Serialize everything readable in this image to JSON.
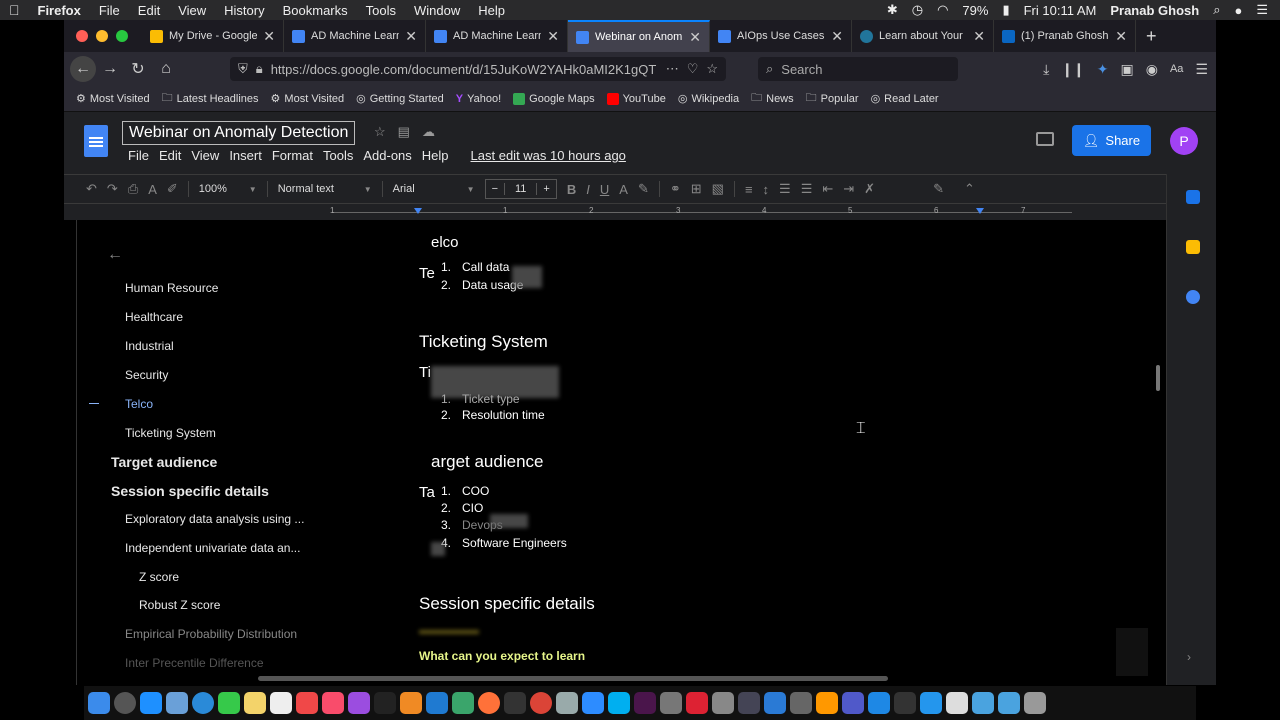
{
  "menubar": {
    "app": "Firefox",
    "items": [
      "File",
      "Edit",
      "View",
      "History",
      "Bookmarks",
      "Tools",
      "Window",
      "Help"
    ],
    "battery": "79%",
    "clock": "Fri 10:11 AM",
    "user": "Pranab Ghosh"
  },
  "tabs": [
    {
      "title": "My Drive - Google"
    },
    {
      "title": "AD Machine Learn"
    },
    {
      "title": "AD Machine Learn"
    },
    {
      "title": "Webinar on Anom"
    },
    {
      "title": "AIOps Use Cases"
    },
    {
      "title": "Learn about Your"
    },
    {
      "title": "(1) Pranab Ghosh"
    }
  ],
  "address": {
    "url": "https://docs.google.com/document/d/15JuKoW2YAHk0aMI2K1gQT",
    "search_placeholder": "Search"
  },
  "bookmarks": [
    "Most Visited",
    "Latest Headlines",
    "Most Visited",
    "Getting Started",
    "Yahoo!",
    "Google Maps",
    "YouTube",
    "Wikipedia",
    "News",
    "Popular",
    "Read Later"
  ],
  "docs": {
    "title": "Webinar on Anomaly Detection",
    "menus": [
      "File",
      "Edit",
      "View",
      "Insert",
      "Format",
      "Tools",
      "Add-ons",
      "Help"
    ],
    "last_edit": "Last edit was 10 hours ago",
    "share_label": "Share",
    "avatar_letter": "P"
  },
  "toolbar": {
    "zoom": "100%",
    "style": "Normal text",
    "font": "Arial",
    "font_size": "11",
    "minus": "−",
    "plus": "+"
  },
  "ruler_numbers": [
    "1",
    "1",
    "2",
    "3",
    "4",
    "5",
    "6",
    "7"
  ],
  "outline": {
    "items": [
      {
        "label": "Human Resource",
        "level": 2
      },
      {
        "label": "Healthcare",
        "level": 2
      },
      {
        "label": "Industrial",
        "level": 2
      },
      {
        "label": "Security",
        "level": 2
      },
      {
        "label": "Telco",
        "level": 2
      },
      {
        "label": "Ticketing System",
        "level": 2
      },
      {
        "label": "Target audience",
        "level": 1
      },
      {
        "label": "Session specific details",
        "level": 1
      },
      {
        "label": "Exploratory data analysis using ...",
        "level": 2
      },
      {
        "label": "Independent univariate data an...",
        "level": 2
      },
      {
        "label": "Z score",
        "level": 3
      },
      {
        "label": "Robust Z score",
        "level": 3
      },
      {
        "label": "Empirical Probability Distribution",
        "level": 2
      },
      {
        "label": "Inter Precentile Difference",
        "level": 2
      }
    ]
  },
  "document": {
    "frag1": "elco",
    "frag2": "Te",
    "telco_items": [
      "1.",
      "Call data",
      "2.",
      "Data usage"
    ],
    "ticketing_heading": "Ticketing System",
    "frag3": "Ti",
    "ticket_items": [
      "1.",
      "Ticket type",
      "2.",
      "Resolution time"
    ],
    "audience_heading": "arget audience",
    "frag4": "Ta",
    "audience_items": [
      "1.",
      "COO",
      "2.",
      "CIO",
      "3.",
      "Devops",
      "4.",
      "Software Engineers"
    ],
    "session_heading": "Session specific details",
    "learn_label": "What can you expect to learn"
  }
}
